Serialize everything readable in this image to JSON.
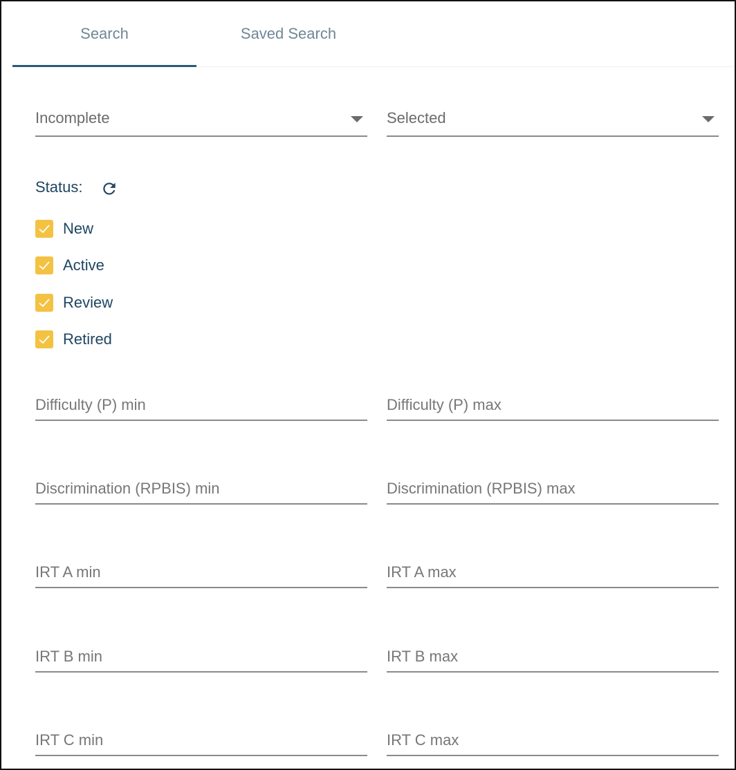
{
  "tabs": {
    "search": "Search",
    "saved_search": "Saved Search"
  },
  "filters": {
    "completeness": "Incomplete",
    "selection": "Selected"
  },
  "status": {
    "label": "Status:",
    "refresh_icon": "refresh-icon",
    "options": [
      {
        "label": "New",
        "checked": true
      },
      {
        "label": "Active",
        "checked": true
      },
      {
        "label": "Review",
        "checked": true
      },
      {
        "label": "Retired",
        "checked": true
      }
    ]
  },
  "ranges": {
    "difficulty_min": "Difficulty (P) min",
    "difficulty_max": "Difficulty (P) max",
    "discrimination_min": "Discrimination (RPBIS) min",
    "discrimination_max": "Discrimination (RPBIS) max",
    "irt_a_min": "IRT A min",
    "irt_a_max": "IRT A max",
    "irt_b_min": "IRT B min",
    "irt_b_max": "IRT B max",
    "irt_c_min": "IRT C min",
    "irt_c_max": "IRT C max"
  },
  "colors": {
    "accent": "#2b5a76",
    "checkbox": "#f4c242",
    "label_text": "#1f4561"
  }
}
